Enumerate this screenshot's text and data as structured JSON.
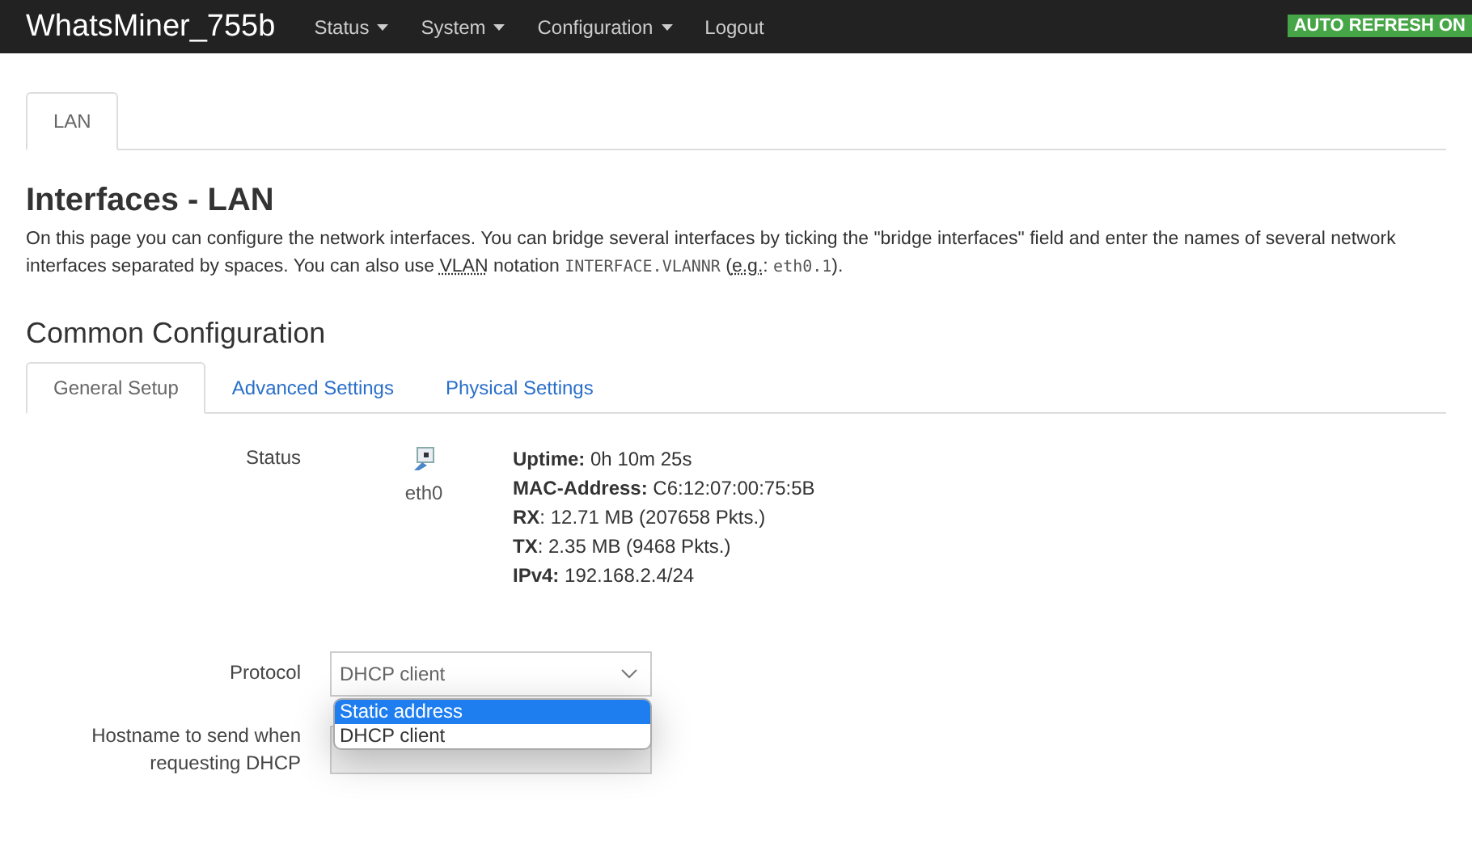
{
  "header": {
    "brand": "WhatsMiner_755b",
    "menu": [
      {
        "label": "Status",
        "dropdown": true
      },
      {
        "label": "System",
        "dropdown": true
      },
      {
        "label": "Configuration",
        "dropdown": true
      },
      {
        "label": "Logout",
        "dropdown": false
      }
    ],
    "badge": "AUTO REFRESH ON"
  },
  "page_tabs": [
    {
      "label": "LAN",
      "selected": true
    }
  ],
  "title": "Interfaces - LAN",
  "description": [
    {
      "kind": "text",
      "text": "On this page you can configure the network interfaces. You can bridge several interfaces by ticking the \"bridge interfaces\" field and enter the names of several network interfaces separated by spaces. You can also use "
    },
    {
      "kind": "abbr",
      "text": "VLAN"
    },
    {
      "kind": "text",
      "text": " notation "
    },
    {
      "kind": "code",
      "text": "INTERFACE.VLANNR"
    },
    {
      "kind": "text",
      "text": " ("
    },
    {
      "kind": "abbr",
      "text": "e.g."
    },
    {
      "kind": "text",
      "text": ": "
    },
    {
      "kind": "code",
      "text": "eth0.1"
    },
    {
      "kind": "text",
      "text": ")."
    }
  ],
  "section_title": "Common Configuration",
  "section_tabs": [
    {
      "label": "General Setup",
      "selected": true
    },
    {
      "label": "Advanced Settings",
      "selected": false
    },
    {
      "label": "Physical Settings",
      "selected": false
    }
  ],
  "status": {
    "label": "Status",
    "device": "eth0",
    "lines": [
      "**Uptime:** 0h 10m 25s",
      "**MAC-Address:** C6:12:07:00:75:5B",
      "**RX**: 12.71 MB (207658 Pkts.)",
      "**TX**: 2.35 MB (9468 Pkts.)",
      "**IPv4:** 192.168.2.4/24"
    ]
  },
  "protocol": {
    "label": "Protocol",
    "value": "DHCP client",
    "options": [
      {
        "label": "Static address",
        "highlighted": true
      },
      {
        "label": "DHCP client",
        "highlighted": false
      }
    ]
  },
  "hostname": {
    "label": "Hostname to send when requesting DHCP"
  }
}
